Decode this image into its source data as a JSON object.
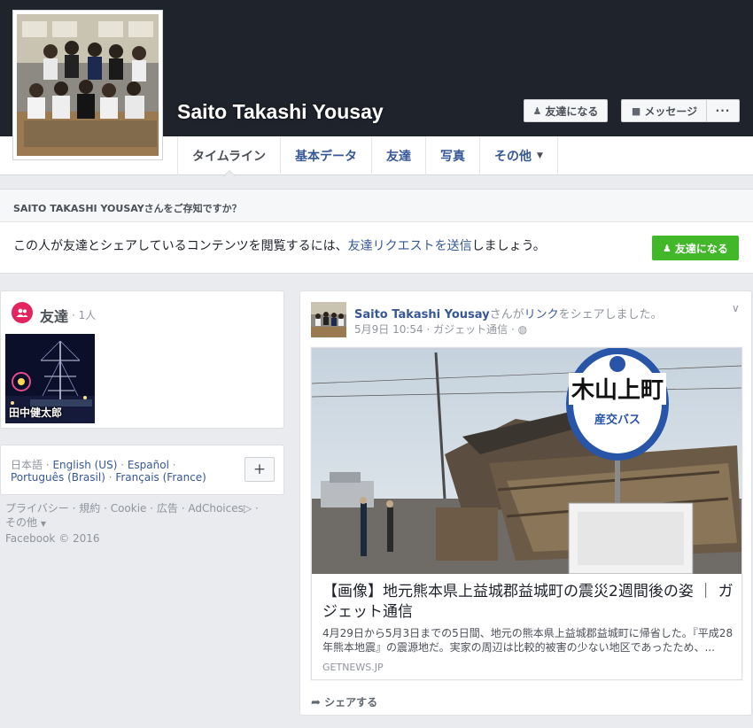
{
  "profile": {
    "name": "Saito Takashi Yousay",
    "add_friend_label": "友達になる",
    "message_label": "メッセージ",
    "more_label": "···"
  },
  "tabs": [
    {
      "label": "タイムライン"
    },
    {
      "label": "基本データ"
    },
    {
      "label": "友達"
    },
    {
      "label": "写真"
    },
    {
      "label": "その他"
    }
  ],
  "know_box": {
    "heading": "SAITO TAKASHI YOUSAYさんをご存知ですか？",
    "text_before": "この人が友達とシェアしているコンテンツを閲覧するには、",
    "link_text": "友達リクエストを送信",
    "text_after": "しましょう。",
    "button_label": "友達になる"
  },
  "friends": {
    "title": "友達",
    "count": "· 1人",
    "items": [
      {
        "name": "田中健太郎"
      }
    ]
  },
  "languages": {
    "line1_current": "日本語",
    "line1_links": [
      "English (US)",
      "Español"
    ],
    "line2_links": [
      "Português (Brasil)",
      "Français (France)"
    ],
    "add_label": "+"
  },
  "footer": {
    "links": [
      "プライバシー",
      "規約",
      "Cookie",
      "広告",
      "AdChoices",
      "その他"
    ],
    "copyright": "Facebook © 2016"
  },
  "post": {
    "author": "Saito Takashi Yousay",
    "action_before": "さんが",
    "action_link": "リンク",
    "action_after": "をシェアしました。",
    "date": "5月9日 10:54",
    "source_app": "ガジェット通信",
    "link": {
      "title": "【画像】地元熊本県上益城郡益城町の震災2週間後の姿 ｜ ガジェット通信",
      "description": "4月29日から5月3日までの5日間、地元の熊本県上益城郡益城町に帰省した。『平成28年熊本地震』の震源地だ。実家の周辺は比較的被害の少ない地区であったため、...",
      "domain": "GETNEWS.JP",
      "sign_text": "木山上町",
      "sign_sub": "産交バス"
    },
    "share_label": "シェアする"
  },
  "colors": {
    "cover": "#1f232b",
    "link": "#365899",
    "green": "#42b72a",
    "friends_badge": "#e4245f",
    "page_bg": "#e9ebee"
  }
}
